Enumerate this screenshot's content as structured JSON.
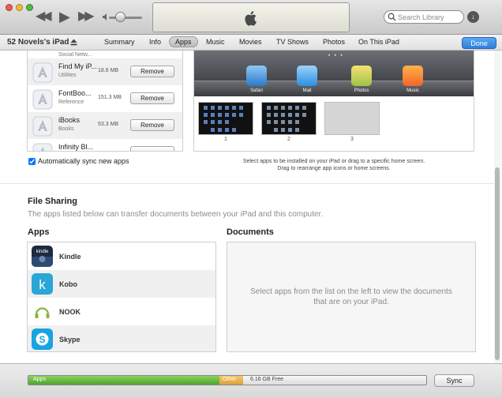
{
  "search": {
    "placeholder": "Search Library"
  },
  "device": {
    "name": "52 Novels's iPad"
  },
  "tabs": [
    "Summary",
    "Info",
    "Apps",
    "Music",
    "Movies",
    "TV Shows",
    "Photos",
    "On This iPad"
  ],
  "active_tab": "Apps",
  "done_label": "Done",
  "app_list": {
    "items": [
      {
        "name": "Find My iP...",
        "category": "Utilities",
        "size": "18.6 MB",
        "button": "Remove"
      },
      {
        "name": "FontBoo...",
        "category": "Reference",
        "size": "151.3 MB",
        "button": "Remove"
      },
      {
        "name": "iBooks",
        "category": "Books",
        "size": "53.3 MB",
        "button": "Remove"
      },
      {
        "name": "Infinity Bl...",
        "category": "",
        "size": "",
        "button": ""
      }
    ]
  },
  "home_screen": {
    "dock_apps": [
      "Safari",
      "Mail",
      "Photos",
      "Music"
    ],
    "pages": [
      "1",
      "2",
      "3"
    ],
    "hint_line1": "Select apps to be installed on your iPad or drag to a specific home screen.",
    "hint_line2": "Drag to rearrange app icons or home screens."
  },
  "auto_sync_label": "Automatically sync new apps",
  "file_sharing": {
    "title": "File Sharing",
    "description": "The apps listed below can transfer documents between your iPad and this computer.",
    "apps_heading": "Apps",
    "documents_heading": "Documents",
    "apps": [
      "Kindle",
      "Kobo",
      "NOOK",
      "Skype"
    ],
    "documents_message_line1": "Select apps from the list on the left to view the documents",
    "documents_message_line2": "that are on your iPad."
  },
  "capacity": {
    "apps_label": "Apps",
    "other_label": "Other",
    "free_label": "6.16 GB Free",
    "apps_fraction": 0.48,
    "other_fraction": 0.06
  },
  "sync_label": "Sync",
  "colors": {
    "accent": "#2d7fd9",
    "apps_segment": "#4ea32e",
    "other_segment": "#dca03a"
  }
}
